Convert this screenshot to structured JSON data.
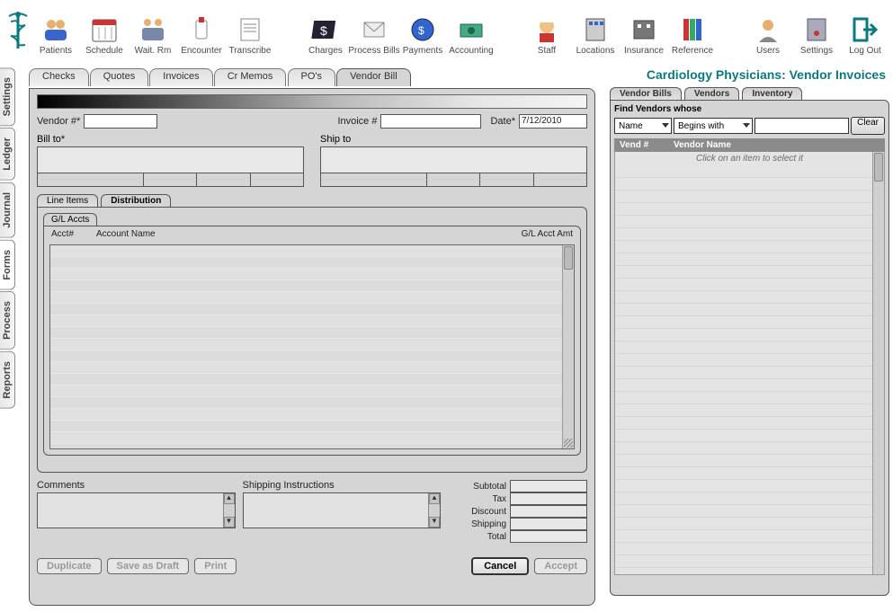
{
  "toolbar": {
    "items": [
      {
        "label": "Patients"
      },
      {
        "label": "Schedule"
      },
      {
        "label": "Wait. Rm"
      },
      {
        "label": "Encounter"
      },
      {
        "label": "Transcribe"
      },
      {
        "label": "Charges"
      },
      {
        "label": "Process Bills"
      },
      {
        "label": "Payments"
      },
      {
        "label": "Accounting"
      },
      {
        "label": "Staff"
      },
      {
        "label": "Locations"
      },
      {
        "label": "Insurance"
      },
      {
        "label": "Reference"
      },
      {
        "label": "Users"
      },
      {
        "label": "Settings"
      },
      {
        "label": "Log Out"
      }
    ]
  },
  "side_tabs": [
    "Settings",
    "Ledger",
    "Journal",
    "Forms",
    "Process",
    "Reports"
  ],
  "side_active": "Forms",
  "doc_tabs": [
    "Checks",
    "Quotes",
    "Invoices",
    "Cr Memos",
    "PO's",
    "Vendor Bill"
  ],
  "doc_active": "Vendor Bill",
  "form": {
    "vendor_num_label": "Vendor #*",
    "vendor_num": "",
    "invoice_num_label": "Invoice #",
    "invoice_num": "",
    "date_label": "Date*",
    "date": "7/12/2010",
    "bill_to_label": "Bill to*",
    "ship_to_label": "Ship to",
    "sub_tabs": [
      "Line Items",
      "Distribution"
    ],
    "sub_active": "Distribution",
    "gl_tab": "G/L Accts",
    "gl_headers": {
      "acct": "Acct#",
      "name": "Account Name",
      "amt": "G/L Acct Amt"
    },
    "comments_label": "Comments",
    "shipping_instructions_label": "Shipping Instructions",
    "totals": {
      "subtotal": {
        "label": "Subtotal",
        "value": ""
      },
      "tax": {
        "label": "Tax",
        "value": ""
      },
      "discount": {
        "label": "Discount",
        "value": ""
      },
      "shipping": {
        "label": "Shipping",
        "value": ""
      },
      "total": {
        "label": "Total",
        "value": ""
      }
    },
    "buttons": {
      "duplicate": "Duplicate",
      "save_draft": "Save as Draft",
      "print": "Print",
      "cancel": "Cancel",
      "accept": "Accept"
    }
  },
  "right": {
    "title": "Cardiology Physicians:  Vendor Invoices",
    "tabs": [
      "Vendor Bills",
      "Vendors",
      "Inventory"
    ],
    "active_tab": "Vendors",
    "find_label": "Find Vendors whose",
    "field_select": "Name",
    "op_select": "Begins with",
    "search_value": "",
    "clear_label": "Clear",
    "list_headers": {
      "vend": "Vend #",
      "name": "Vendor Name"
    },
    "hint": "Click on an item to select it"
  },
  "colors": {
    "teal": "#0b7a80"
  }
}
